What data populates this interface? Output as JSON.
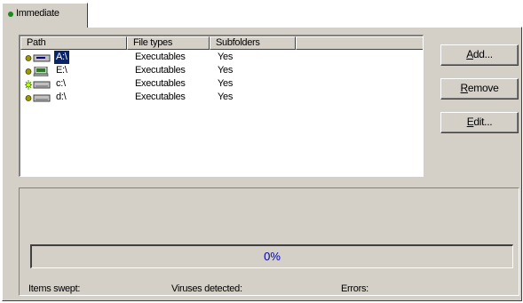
{
  "tab": {
    "label": "Immediate"
  },
  "list": {
    "columns": [
      "Path",
      "File types",
      "Subfolders"
    ],
    "rows": [
      {
        "icon": "floppy-drive-icon",
        "path": "A:\\",
        "file_types": "Executables",
        "subfolders": "Yes",
        "selected": true
      },
      {
        "icon": "network-drive-icon",
        "path": "E:\\",
        "file_types": "Executables",
        "subfolders": "Yes",
        "selected": false
      },
      {
        "icon": "hard-drive-icon",
        "path": "c:\\",
        "file_types": "Executables",
        "subfolders": "Yes",
        "selected": false
      },
      {
        "icon": "hard-drive-icon",
        "path": "d:\\",
        "file_types": "Executables",
        "subfolders": "Yes",
        "selected": false
      }
    ]
  },
  "buttons": {
    "add": {
      "mnemonic": "A",
      "rest": "dd..."
    },
    "remove": {
      "mnemonic": "R",
      "rest": "emove"
    },
    "edit": {
      "mnemonic": "E",
      "rest": "dit..."
    }
  },
  "progress": {
    "value": 0,
    "label": "0%"
  },
  "status": {
    "items_swept": "Items swept:",
    "viruses_detected": "Viruses detected:",
    "errors": "Errors:"
  },
  "colors": {
    "face": "#d4d0c8",
    "selection": "#0a246a",
    "progress_text": "#0000a0",
    "status_dot": "#1a8a1a"
  }
}
